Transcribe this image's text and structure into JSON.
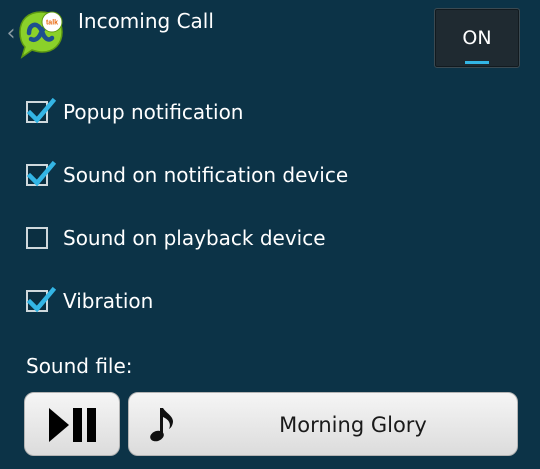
{
  "header": {
    "title": "Incoming Call",
    "back_icon": "chevron-left-icon",
    "logo_text": "talk",
    "toggle_label": "ON",
    "toggle_state": "on"
  },
  "options": [
    {
      "label": "Popup notification",
      "checked": true
    },
    {
      "label": "Sound on notification device",
      "checked": true
    },
    {
      "label": "Sound on playback device",
      "checked": false
    },
    {
      "label": "Vibration",
      "checked": true
    }
  ],
  "sound": {
    "label": "Sound file:",
    "file_name": "Morning Glory",
    "play_icon": "play-pause-icon",
    "note_icon": "music-note-icon"
  },
  "colors": {
    "background": "#0c3347",
    "accent": "#33b5e5",
    "logo_green": "#8bd12a"
  }
}
